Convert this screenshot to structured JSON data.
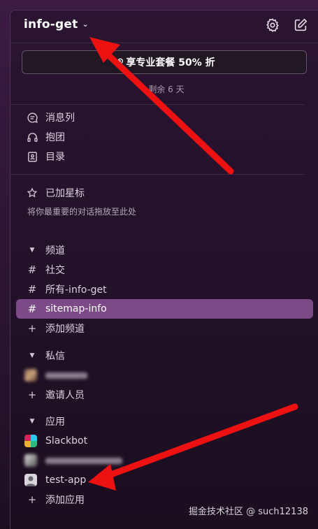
{
  "workspace": {
    "name": "info-get"
  },
  "promo": {
    "label": "享专业套餐 50% 折"
  },
  "trial": {
    "text": "剩余 6 天"
  },
  "nav": [
    {
      "label": "消息列",
      "icon": "message-list-icon"
    },
    {
      "label": "抱团",
      "icon": "headphones-icon"
    },
    {
      "label": "目录",
      "icon": "directory-icon"
    }
  ],
  "starred": {
    "label": "已加星标",
    "hint": "将你最重要的对话拖放至此处"
  },
  "channels": {
    "label": "频道",
    "items": [
      "社交",
      "所有-info-get",
      "sitemap-info"
    ],
    "active": "sitemap-info",
    "add_label": "添加频道"
  },
  "dms": {
    "label": "私信",
    "invite_label": "邀请人员"
  },
  "apps": {
    "label": "应用",
    "items": [
      "Slackbot",
      "test-app"
    ],
    "add_label": "添加应用"
  },
  "watermark": "掘金技术社区 @ such12138",
  "colors": {
    "active": "#7b4a87",
    "arrow": "#ee1111",
    "sidebar": "#2b1431"
  }
}
